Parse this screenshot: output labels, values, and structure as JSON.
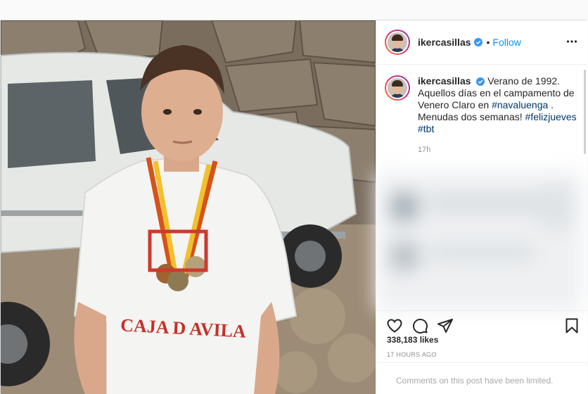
{
  "post": {
    "author": {
      "username": "ikercasillas",
      "verified": true,
      "follow_label": "Follow",
      "separator": "•"
    },
    "caption": {
      "username": "ikercasillas",
      "lead": "Verano de 1992. Aquellos días en el campamento de Venero Claro en",
      "hashtag1": "#navaluenga",
      "middle": ". Menudas dos semanas!",
      "hashtag2": "#felizjueves",
      "hashtag3": "#tbt",
      "time": "17h"
    },
    "photo": {
      "shirt_text": "CAJA D AVILA"
    },
    "likes": "338,183 likes",
    "posted_ago": "17 HOURS AGO",
    "comments_notice": "Comments on this post have been limited.",
    "icons": {
      "like": "heart-icon",
      "comment": "comment-icon",
      "share": "send-icon",
      "save": "bookmark-icon",
      "more": "more-options-icon",
      "verified": "verified-badge-icon"
    },
    "colors": {
      "link_blue": "#0095f6",
      "hashtag": "#00376b",
      "muted": "#8e8e8e"
    }
  }
}
